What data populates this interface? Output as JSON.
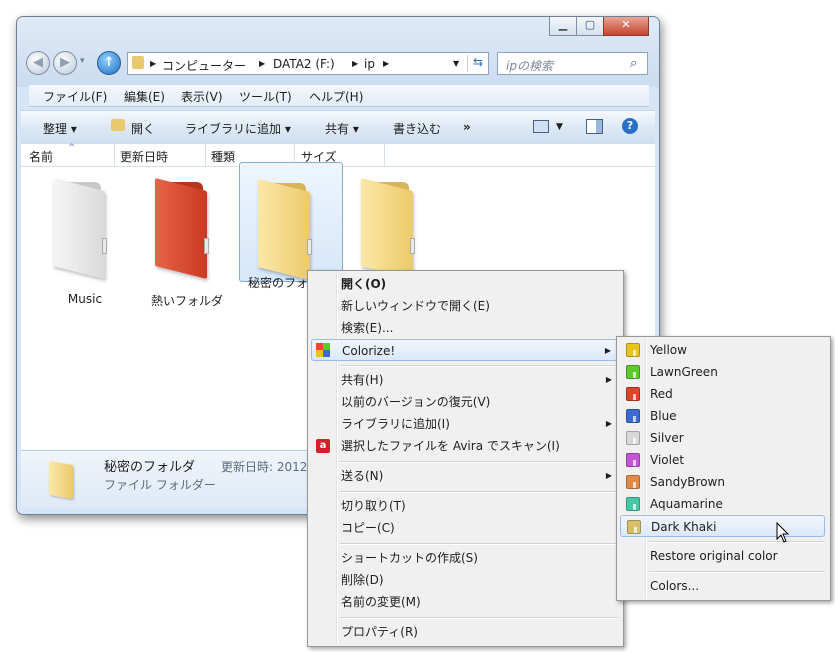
{
  "colors": {
    "window_frame": "#d7e6f6",
    "folder_white": "#e2e2e2",
    "folder_red": "#d9442b",
    "folder_yellow": "#f4dc8e",
    "yellow": "#e8c31c",
    "lawngreen": "#5cc92d",
    "red": "#d9442b",
    "blue": "#3d6bd0",
    "silver": "#d8d8d8",
    "violet": "#c356d4",
    "sandybrown": "#e08a4a",
    "aquamarine": "#46c7a8",
    "darkkhaki": "#d7c06a"
  },
  "address": {
    "segments": [
      "コンピューター",
      "DATA2 (F:)",
      "ip"
    ],
    "search_placeholder": "ipの検索"
  },
  "menubar": [
    "ファイル(F)",
    "編集(E)",
    "表示(V)",
    "ツール(T)",
    "ヘルプ(H)"
  ],
  "toolbar": {
    "organize": "整理 ▾",
    "open": "開く",
    "add_to_library": "ライブラリに追加 ▾",
    "share": "共有 ▾",
    "burn": "書き込む",
    "more": "»"
  },
  "columns": [
    "名前",
    "更新日時",
    "種類",
    "サイズ"
  ],
  "folders": [
    {
      "label": "Music"
    },
    {
      "label": "熱いフォルダ"
    },
    {
      "label": "秘密のフォルダ"
    },
    {
      "label": ""
    }
  ],
  "details": {
    "name": "秘密のフォルダ",
    "modified": "更新日時: 2012",
    "type": "ファイル フォルダー"
  },
  "context_menu": [
    {
      "label": "開く(O)"
    },
    {
      "label": "新しいウィンドウで開く(E)"
    },
    {
      "label": "検索(E)..."
    },
    {
      "label": "Colorize!"
    },
    {
      "label": "共有(H)"
    },
    {
      "label": "以前のバージョンの復元(V)"
    },
    {
      "label": "ライブラリに追加(I)"
    },
    {
      "label": "選択したファイルを Avira でスキャン(I)"
    },
    {
      "label": "送る(N)"
    },
    {
      "label": "切り取り(T)"
    },
    {
      "label": "コピー(C)"
    },
    {
      "label": "ショートカットの作成(S)"
    },
    {
      "label": "削除(D)"
    },
    {
      "label": "名前の変更(M)"
    },
    {
      "label": "プロパティ(R)"
    }
  ],
  "submenu": [
    {
      "label": "Yellow"
    },
    {
      "label": "LawnGreen"
    },
    {
      "label": "Red"
    },
    {
      "label": "Blue"
    },
    {
      "label": "Silver"
    },
    {
      "label": "Violet"
    },
    {
      "label": "SandyBrown"
    },
    {
      "label": "Aquamarine"
    },
    {
      "label": "Dark Khaki"
    },
    {
      "label": "Restore original color"
    },
    {
      "label": "Colors..."
    }
  ]
}
